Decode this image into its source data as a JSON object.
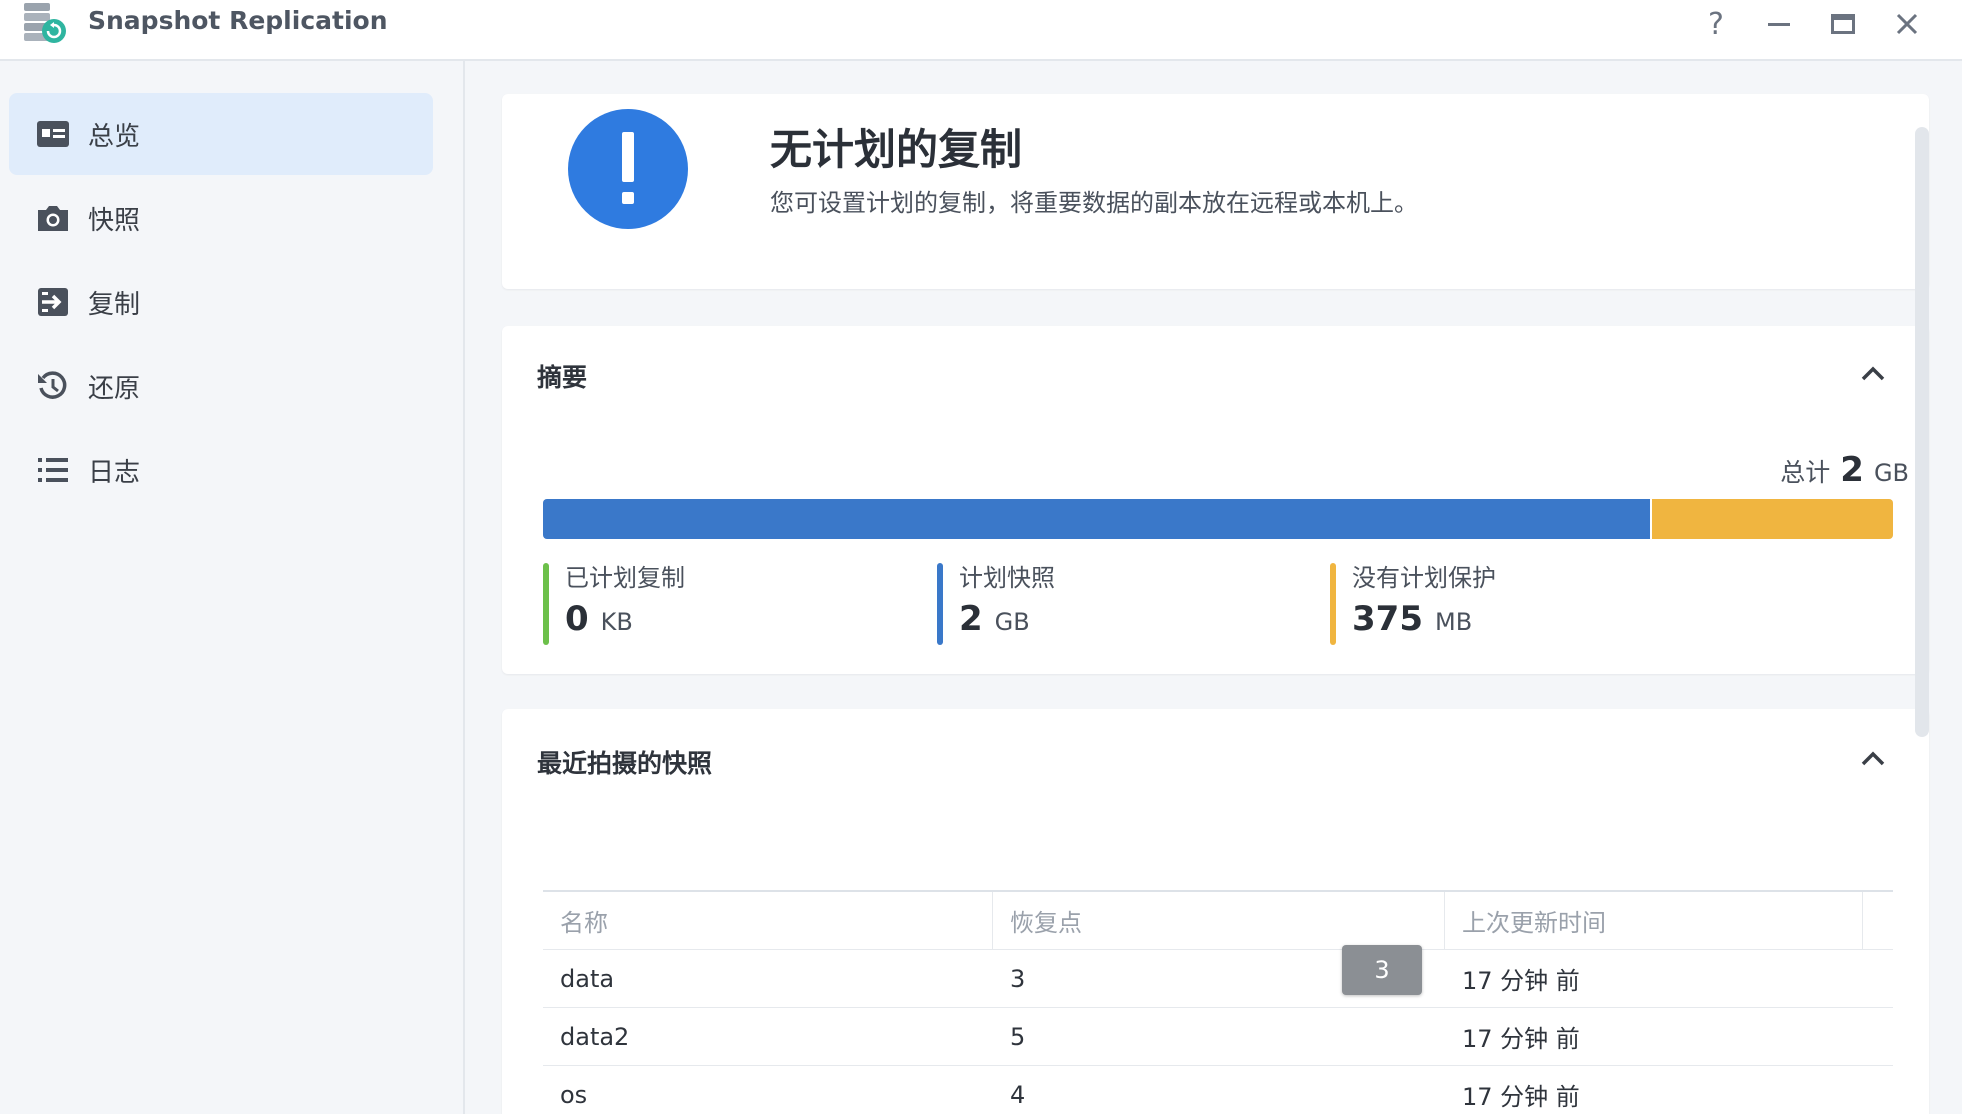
{
  "window": {
    "title": "Snapshot Replication",
    "controls": {
      "help": "?"
    }
  },
  "sidebar": {
    "items": [
      {
        "label": "总览",
        "icon": "overview-icon",
        "active": true
      },
      {
        "label": "快照",
        "icon": "camera-icon",
        "active": false
      },
      {
        "label": "复制",
        "icon": "replication-icon",
        "active": false
      },
      {
        "label": "还原",
        "icon": "restore-icon",
        "active": false
      },
      {
        "label": "日志",
        "icon": "list-icon",
        "active": false
      }
    ]
  },
  "status": {
    "icon": "exclamation-icon",
    "title": "无计划的复制",
    "description": "您可设置计划的复制，将重要数据的副本放在远程或本机上。",
    "color": "#2f7be0"
  },
  "summary": {
    "header": "摘要",
    "total_label": "总计",
    "total_value": "2",
    "total_unit": "GB",
    "usage": {
      "snapshot_fraction": 0.82,
      "unprotected_fraction": 0.18
    },
    "legend": [
      {
        "label": "已计划复制",
        "value": "0",
        "unit": "KB",
        "color": "#6cc04a"
      },
      {
        "label": "计划快照",
        "value": "2",
        "unit": "GB",
        "color": "#3a78c9"
      },
      {
        "label": "没有计划保护",
        "value": "375",
        "unit": "MB",
        "color": "#f0b540"
      }
    ]
  },
  "recent": {
    "header": "最近拍摄的快照",
    "columns": [
      "名称",
      "恢复点",
      "上次更新时间"
    ],
    "rows": [
      {
        "name": "data",
        "restore_points": "3",
        "updated": "17 分钟 前"
      },
      {
        "name": "data2",
        "restore_points": "5",
        "updated": "17 分钟 前"
      },
      {
        "name": "os",
        "restore_points": "4",
        "updated": "17 分钟 前"
      }
    ],
    "tooltip": "3"
  }
}
